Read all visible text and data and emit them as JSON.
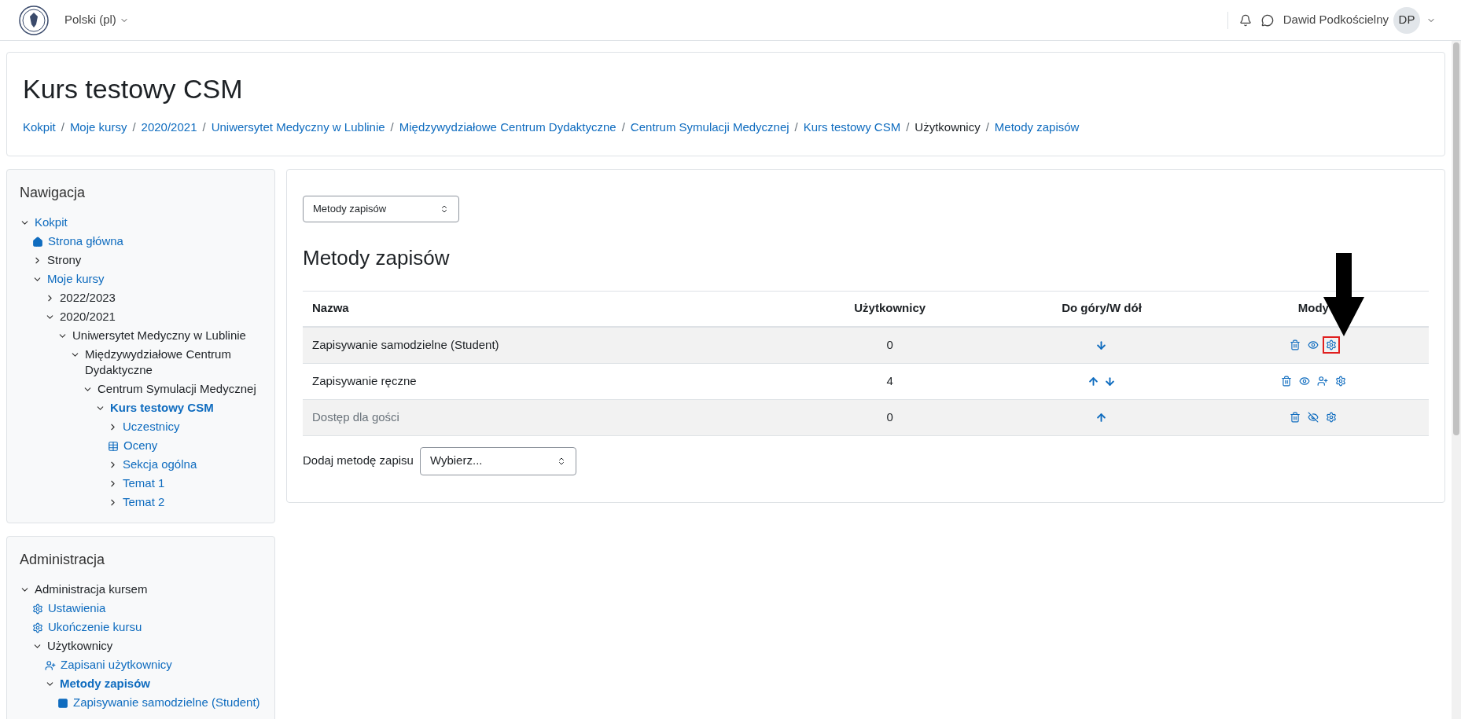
{
  "topbar": {
    "language": "Polski (pl)",
    "user_name": "Dawid Podkościelny",
    "avatar_initials": "DP"
  },
  "course_header": {
    "title": "Kurs testowy CSM",
    "breadcrumbs": [
      {
        "label": "Kokpit",
        "link": true
      },
      {
        "separator": "/",
        "label": "Moje kursy",
        "link": true
      },
      {
        "separator": "/",
        "label": "2020/2021",
        "link": true
      },
      {
        "separator": "/",
        "label": "Uniwersytet Medyczny w Lublinie",
        "link": true
      },
      {
        "separator": "/",
        "label": "Międzywydziałowe Centrum Dydaktyczne",
        "link": true
      },
      {
        "separator": "/",
        "label": "Centrum Symulacji Medycznej",
        "link": true
      },
      {
        "separator": "/",
        "label": "Kurs testowy CSM",
        "link": true
      },
      {
        "separator": "/",
        "label": "Użytkownicy",
        "link": false
      },
      {
        "separator": "/",
        "label": "Metody zapisów",
        "link": true
      }
    ]
  },
  "navigation": {
    "title": "Nawigacja",
    "items": [
      {
        "label": "Kokpit",
        "kind": "branch",
        "expanded": true,
        "link": true,
        "bold": false,
        "children": [
          {
            "label": "Strona główna",
            "kind": "home",
            "link": true,
            "bold": false
          },
          {
            "label": "Strony",
            "kind": "branch",
            "expanded": false,
            "link": false,
            "bold": false
          },
          {
            "label": "Moje kursy",
            "kind": "branch",
            "expanded": true,
            "link": true,
            "bold": false,
            "children": [
              {
                "label": "2022/2023",
                "kind": "branch",
                "expanded": false,
                "link": false,
                "bold": false
              },
              {
                "label": "2020/2021",
                "kind": "branch",
                "expanded": true,
                "link": false,
                "bold": false,
                "children": [
                  {
                    "label": "Uniwersytet Medyczny w Lublinie",
                    "kind": "branch",
                    "expanded": true,
                    "link": false,
                    "bold": false,
                    "children": [
                      {
                        "label": "Międzywydziałowe Centrum Dydaktyczne",
                        "kind": "branch",
                        "expanded": true,
                        "link": false,
                        "bold": false,
                        "children": [
                          {
                            "label": "Centrum Symulacji Medycznej",
                            "kind": "branch",
                            "expanded": true,
                            "link": false,
                            "bold": false,
                            "children": [
                              {
                                "label": "Kurs testowy CSM",
                                "kind": "branch",
                                "expanded": true,
                                "link": true,
                                "bold": true,
                                "children": [
                                  {
                                    "label": "Uczestnicy",
                                    "kind": "branch",
                                    "expanded": false,
                                    "link": true,
                                    "bold": false
                                  },
                                  {
                                    "label": "Oceny",
                                    "kind": "table",
                                    "link": true,
                                    "bold": false
                                  },
                                  {
                                    "label": "Sekcja ogólna",
                                    "kind": "branch",
                                    "expanded": false,
                                    "link": true,
                                    "bold": false
                                  },
                                  {
                                    "label": "Temat 1",
                                    "kind": "branch",
                                    "expanded": false,
                                    "link": true,
                                    "bold": false
                                  },
                                  {
                                    "label": "Temat 2",
                                    "kind": "branch",
                                    "expanded": false,
                                    "link": true,
                                    "bold": false
                                  }
                                ]
                              }
                            ]
                          }
                        ]
                      }
                    ]
                  }
                ]
              }
            ]
          }
        ]
      }
    ]
  },
  "administration": {
    "title": "Administracja",
    "items": [
      {
        "label": "Administracja kursem",
        "kind": "branch",
        "expanded": true,
        "link": false,
        "bold": false,
        "children": [
          {
            "label": "Ustawienia",
            "kind": "gear",
            "link": true,
            "bold": false
          },
          {
            "label": "Ukończenie kursu",
            "kind": "gear",
            "link": true,
            "bold": false
          },
          {
            "label": "Użytkownicy",
            "kind": "branch",
            "expanded": true,
            "link": false,
            "bold": false,
            "children": [
              {
                "label": "Zapisani użytkownicy",
                "kind": "user-plus",
                "link": true,
                "bold": false
              },
              {
                "label": "Metody zapisów",
                "kind": "branch",
                "expanded": true,
                "link": true,
                "bold": true,
                "children": [
                  {
                    "label": "Zapisywanie samodzielne (Student)",
                    "kind": "square",
                    "link": true,
                    "bold": false
                  }
                ]
              }
            ]
          }
        ]
      }
    ]
  },
  "main": {
    "page_select": "Metody zapisów",
    "heading": "Metody zapisów",
    "table": {
      "columns": [
        "Nazwa",
        "Użytkownicy",
        "Do góry/W dół",
        "Mody"
      ],
      "rows": [
        {
          "name": "Zapisywanie samodzielne (Student)",
          "users": "0",
          "disabled": false,
          "moves": [
            {
              "kind": "down"
            }
          ],
          "actions": [
            {
              "kind": "delete",
              "highlighted": false
            },
            {
              "kind": "hide",
              "highlighted": false
            },
            {
              "kind": "settings",
              "highlighted": true
            }
          ]
        },
        {
          "name": "Zapisywanie ręczne",
          "users": "4",
          "disabled": false,
          "moves": [
            {
              "kind": "up"
            },
            {
              "kind": "down"
            }
          ],
          "actions": [
            {
              "kind": "delete",
              "highlighted": false
            },
            {
              "kind": "hide",
              "highlighted": false
            },
            {
              "kind": "enrol",
              "highlighted": false
            },
            {
              "kind": "settings",
              "highlighted": false
            }
          ]
        },
        {
          "name": "Dostęp dla gości",
          "users": "0",
          "disabled": true,
          "moves": [
            {
              "kind": "up"
            }
          ],
          "actions": [
            {
              "kind": "delete",
              "highlighted": false
            },
            {
              "kind": "show",
              "highlighted": false
            },
            {
              "kind": "settings",
              "highlighted": false
            }
          ]
        }
      ]
    },
    "add_method": {
      "label": "Dodaj metodę zapisu",
      "value": "Wybierz..."
    }
  }
}
